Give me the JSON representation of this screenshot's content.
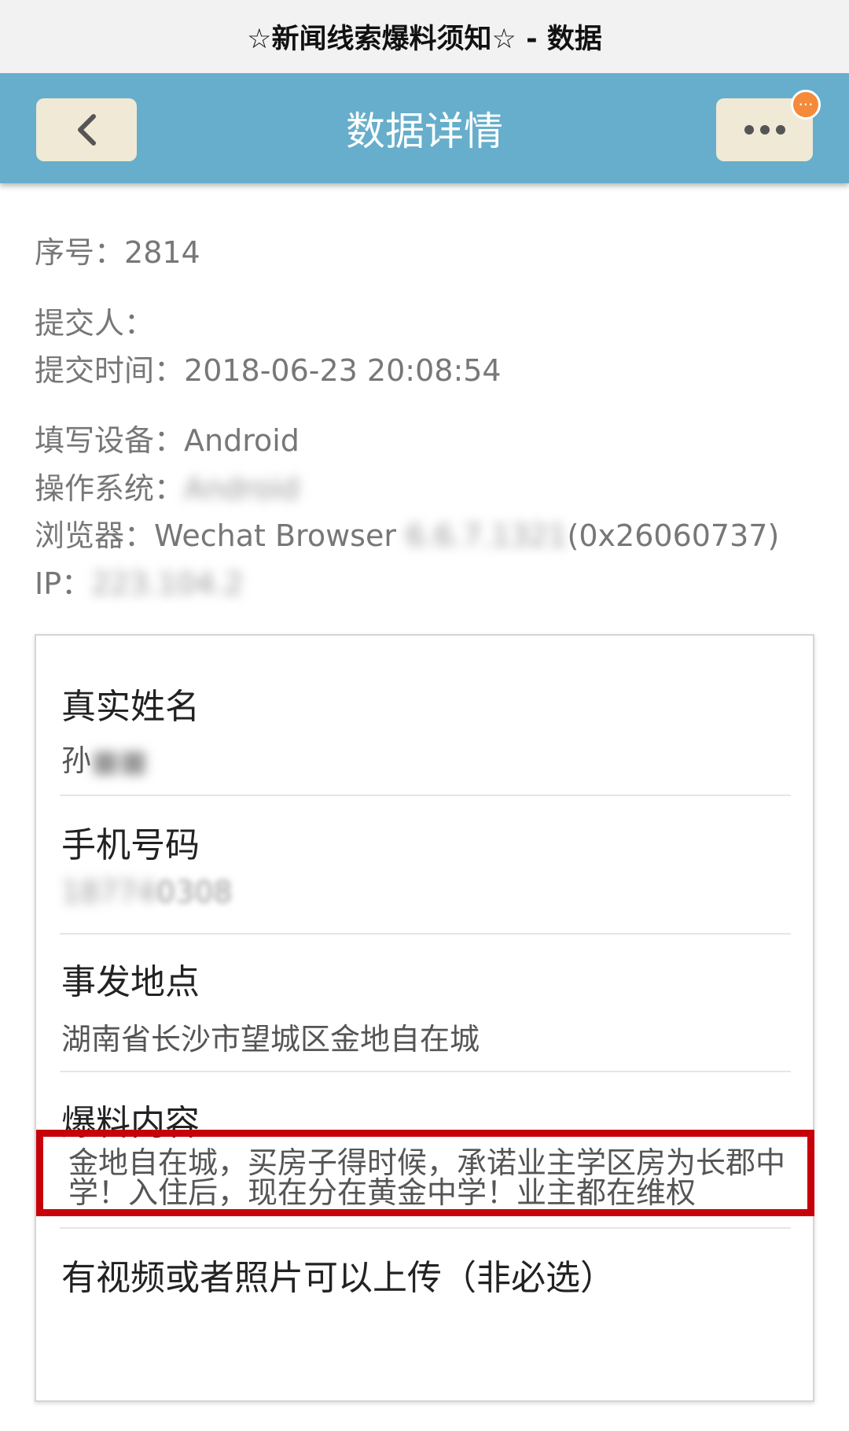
{
  "window": {
    "title": "☆新闻线索爆料须知☆ - 数据"
  },
  "navbar": {
    "title": "数据详情",
    "badge": "···"
  },
  "meta": {
    "serial_label": "序号：",
    "serial": "2814",
    "submitter_label": "提交人：",
    "submitter": "",
    "submit_time_label": "提交时间：",
    "submit_time": "2018-06-23 20:08:54",
    "device_label": "填写设备：",
    "device": "Android",
    "os_label": "操作系统：",
    "os": "Android",
    "browser_label": "浏览器：",
    "browser_prefix": "Wechat Browser",
    "browser_version": "6.6.7.1321",
    "browser_suffix": "(0x26060737)",
    "ip_label": "IP：",
    "ip": "223.104.2"
  },
  "form": {
    "name": {
      "label": "真实姓名",
      "value": "孙"
    },
    "phone": {
      "label": "手机号码",
      "value": "18774",
      "value_tail": "0308"
    },
    "location": {
      "label": "事发地点",
      "value": "湖南省长沙市望城区金地自在城"
    },
    "content": {
      "label": "爆料内容",
      "value": "金地自在城，买房子得时候，承诺业主学区房为长郡中学！入住后，现在分在黄金中学！业主都在维权"
    },
    "upload": {
      "label": "有视频或者照片可以上传（非必选）"
    }
  },
  "colors": {
    "navbar": "#66aecb",
    "button": "#efe9d6",
    "badge": "#f48a3a",
    "highlight": "#c8000a"
  },
  "icons": {
    "back": "chevron-left-icon",
    "more": "more-horizontal-icon"
  }
}
